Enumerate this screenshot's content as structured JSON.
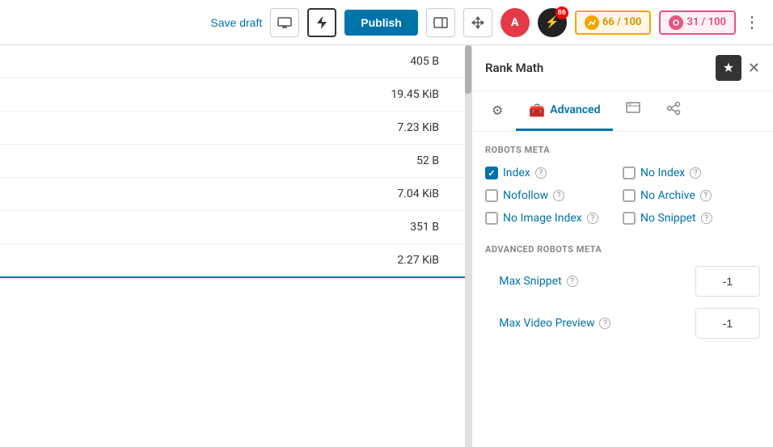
{
  "toolbar": {
    "save_draft_label": "Save draft",
    "publish_label": "Publish",
    "score_badge_1": "66 / 100",
    "score_badge_2": "31 / 100",
    "notification_count": "86",
    "more_icon": "⋮"
  },
  "file_list": {
    "rows": [
      {
        "size": "405 B"
      },
      {
        "size": "19.45 KiB"
      },
      {
        "size": "7.23 KiB"
      },
      {
        "size": "52 B"
      },
      {
        "size": "7.04 KiB"
      },
      {
        "size": "351 B"
      },
      {
        "size": "2.27 KiB"
      }
    ]
  },
  "rank_math": {
    "panel_title": "Rank Math",
    "tabs": [
      {
        "id": "settings",
        "icon": "⚙",
        "label": ""
      },
      {
        "id": "advanced",
        "icon": "🧰",
        "label": "Advanced"
      },
      {
        "id": "social",
        "icon": "🖼",
        "label": ""
      },
      {
        "id": "schema",
        "icon": "⑂",
        "label": ""
      }
    ],
    "robots_meta": {
      "section_label": "ROBOTS META",
      "checkboxes": [
        {
          "id": "index",
          "label": "Index",
          "checked": true,
          "col": 0
        },
        {
          "id": "no-index",
          "label": "No Index",
          "checked": false,
          "col": 1
        },
        {
          "id": "nofollow",
          "label": "Nofollow",
          "checked": false,
          "col": 0
        },
        {
          "id": "no-archive",
          "label": "No Archive",
          "checked": false,
          "col": 1
        },
        {
          "id": "no-image-index",
          "label": "No Image Index",
          "checked": false,
          "col": 0
        },
        {
          "id": "no-snippet",
          "label": "No Snippet",
          "checked": false,
          "col": 1
        }
      ]
    },
    "advanced_robots_meta": {
      "section_label": "ADVANCED ROBOTS META",
      "rows": [
        {
          "id": "max-snippet",
          "label": "Max Snippet",
          "checked": true,
          "value": "-1"
        },
        {
          "id": "max-video-preview",
          "label": "Max Video Preview",
          "checked": true,
          "value": "-1"
        }
      ]
    }
  }
}
